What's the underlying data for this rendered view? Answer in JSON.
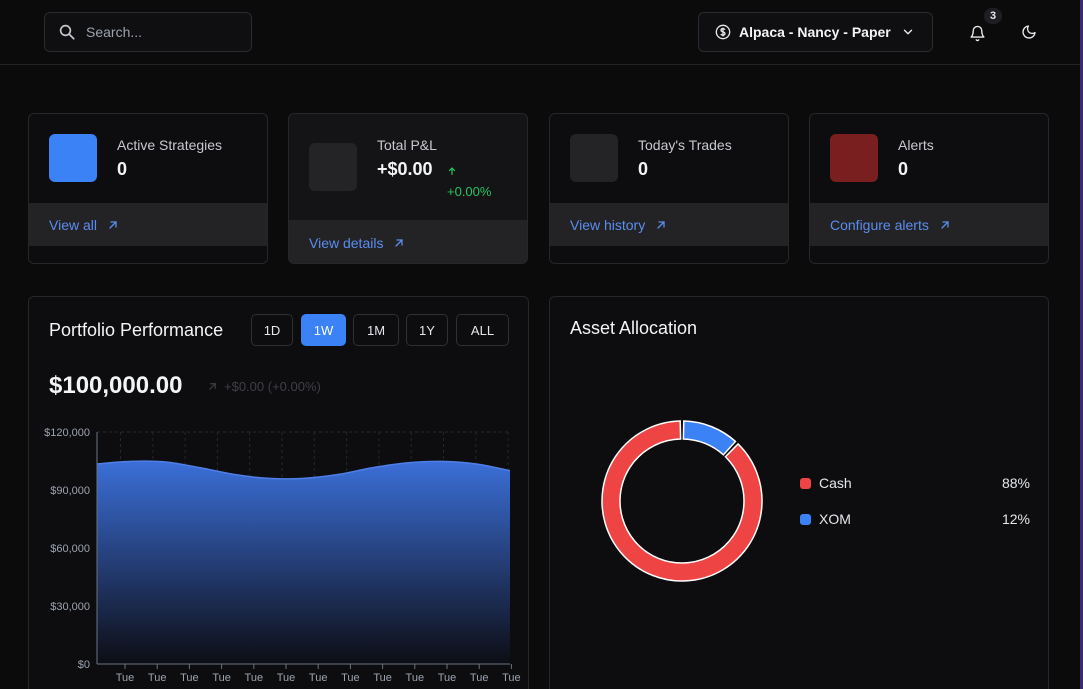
{
  "header": {
    "search_placeholder": "Search...",
    "account_label": "Alpaca - Nancy - Paper",
    "notifications_count": "3"
  },
  "stats": [
    {
      "title": "Active Strategies",
      "value": "0",
      "link": "View all",
      "color": "#3b82f6"
    },
    {
      "title": "Total P&L",
      "value": "+$0.00",
      "change": "+0.00%",
      "link": "View details",
      "color": "#242427"
    },
    {
      "title": "Today's Trades",
      "value": "0",
      "link": "View history",
      "color": "#242427"
    },
    {
      "title": "Alerts",
      "value": "0",
      "link": "Configure alerts",
      "color": "#7a1f1f"
    }
  ],
  "performance": {
    "title": "Portfolio Performance",
    "ranges": [
      "1D",
      "1W",
      "1M",
      "1Y",
      "ALL"
    ],
    "active_range": "1W",
    "balance": "$100,000.00",
    "change": "+$0.00 (+0.00%)"
  },
  "allocation": {
    "title": "Asset Allocation",
    "items": [
      {
        "name": "Cash",
        "pct": "88%",
        "color": "#ef4444"
      },
      {
        "name": "XOM",
        "pct": "12%",
        "color": "#3b82f6"
      }
    ]
  },
  "chart_data": [
    {
      "type": "area",
      "x": [
        "Tue",
        "Tue",
        "Tue",
        "Tue",
        "Tue",
        "Tue",
        "Tue",
        "Tue",
        "Tue",
        "Tue",
        "Tue",
        "Tue",
        "Tue"
      ],
      "y": [
        103500,
        104800,
        104500,
        101500,
        98000,
        96000,
        96000,
        98000,
        101500,
        104000,
        104800,
        103500,
        100000
      ],
      "ylim": [
        0,
        120000
      ],
      "yticks": [
        "$0",
        "$30,000",
        "$60,000",
        "$90,000",
        "$120,000"
      ],
      "grid": true,
      "color": "#3b6fd8"
    },
    {
      "type": "pie",
      "categories": [
        "Cash",
        "XOM"
      ],
      "values": [
        88,
        12
      ]
    }
  ]
}
